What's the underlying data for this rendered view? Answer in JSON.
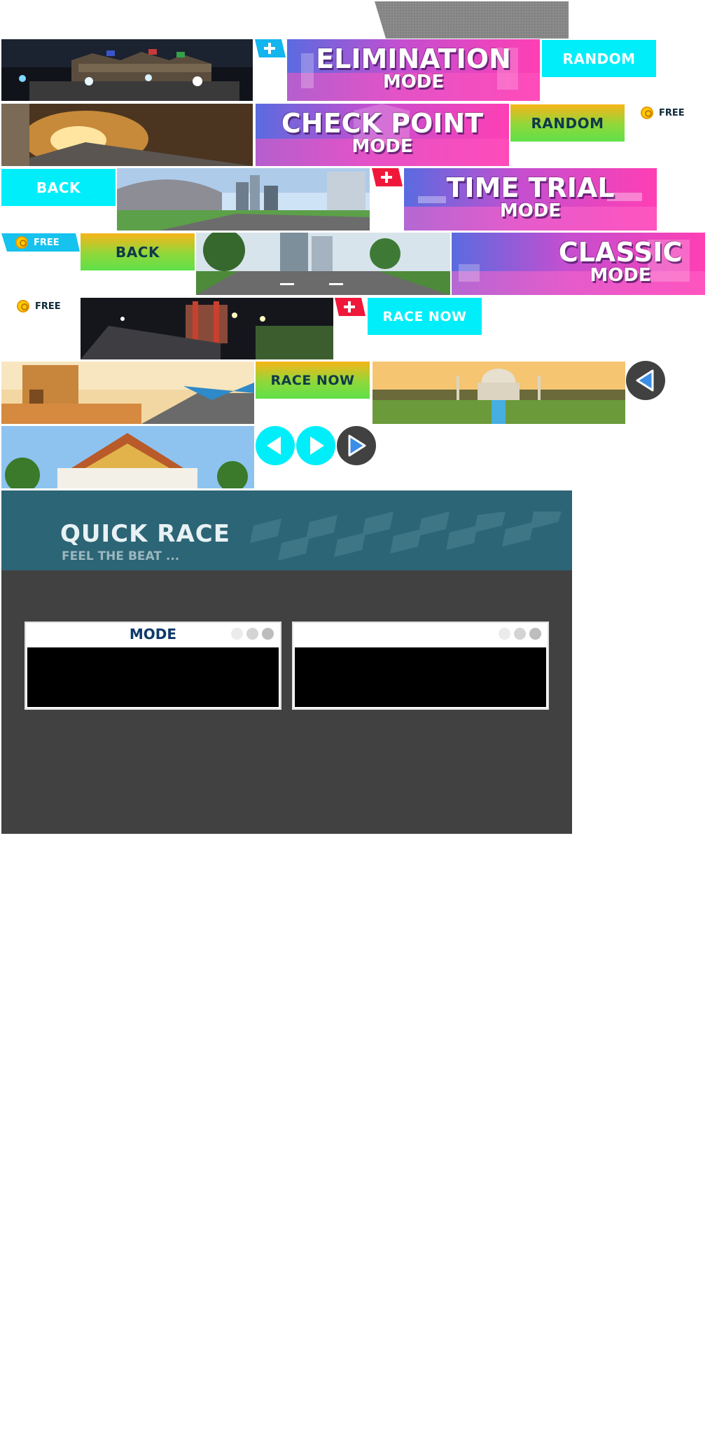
{
  "buttons": {
    "elimination_line1": "ELIMINATION",
    "elimination_line2": "MODE",
    "checkpoint_line1": "CHECK POINT",
    "checkpoint_line2": "MODE",
    "timetrial_line1": "TIME TRIAL",
    "timetrial_line2": "MODE",
    "classic_line1": "CLASSIC",
    "classic_line2": "MODE",
    "random_cyan": "RANDOM",
    "random_grad": "RANDOM",
    "back_cyan": "BACK",
    "back_grad": "BACK",
    "race_now_cyan": "RACE NOW",
    "race_now_grad": "RACE NOW",
    "free_1": "FREE",
    "free_2": "FREE",
    "free_3": "FREE"
  },
  "quick_race": {
    "title": "QUICK RACE",
    "subtitle": "FEEL THE BEAT ...",
    "mode_panel_title": "MODE",
    "second_panel_title": ""
  },
  "thumbnails": [
    {
      "scene": "great-wall-night-track"
    },
    {
      "scene": "tunnel-track"
    },
    {
      "scene": "stadium-city-track"
    },
    {
      "scene": "city-park-road-track"
    },
    {
      "scene": "night-temple-bridge-track"
    },
    {
      "scene": "desert-camel-track"
    },
    {
      "scene": "taj-mahal-garden-track"
    },
    {
      "scene": "thai-palace-track"
    }
  ],
  "icons": {
    "plus": "plus-icon",
    "coin": "coin-icon",
    "arrow_left": "arrow-left-icon",
    "arrow_right": "arrow-right-icon"
  },
  "colors": {
    "cyan": "#00eef9",
    "teal_header": "#2c6575",
    "dark_panel": "#414141",
    "navy_text": "#0e3a6a"
  }
}
